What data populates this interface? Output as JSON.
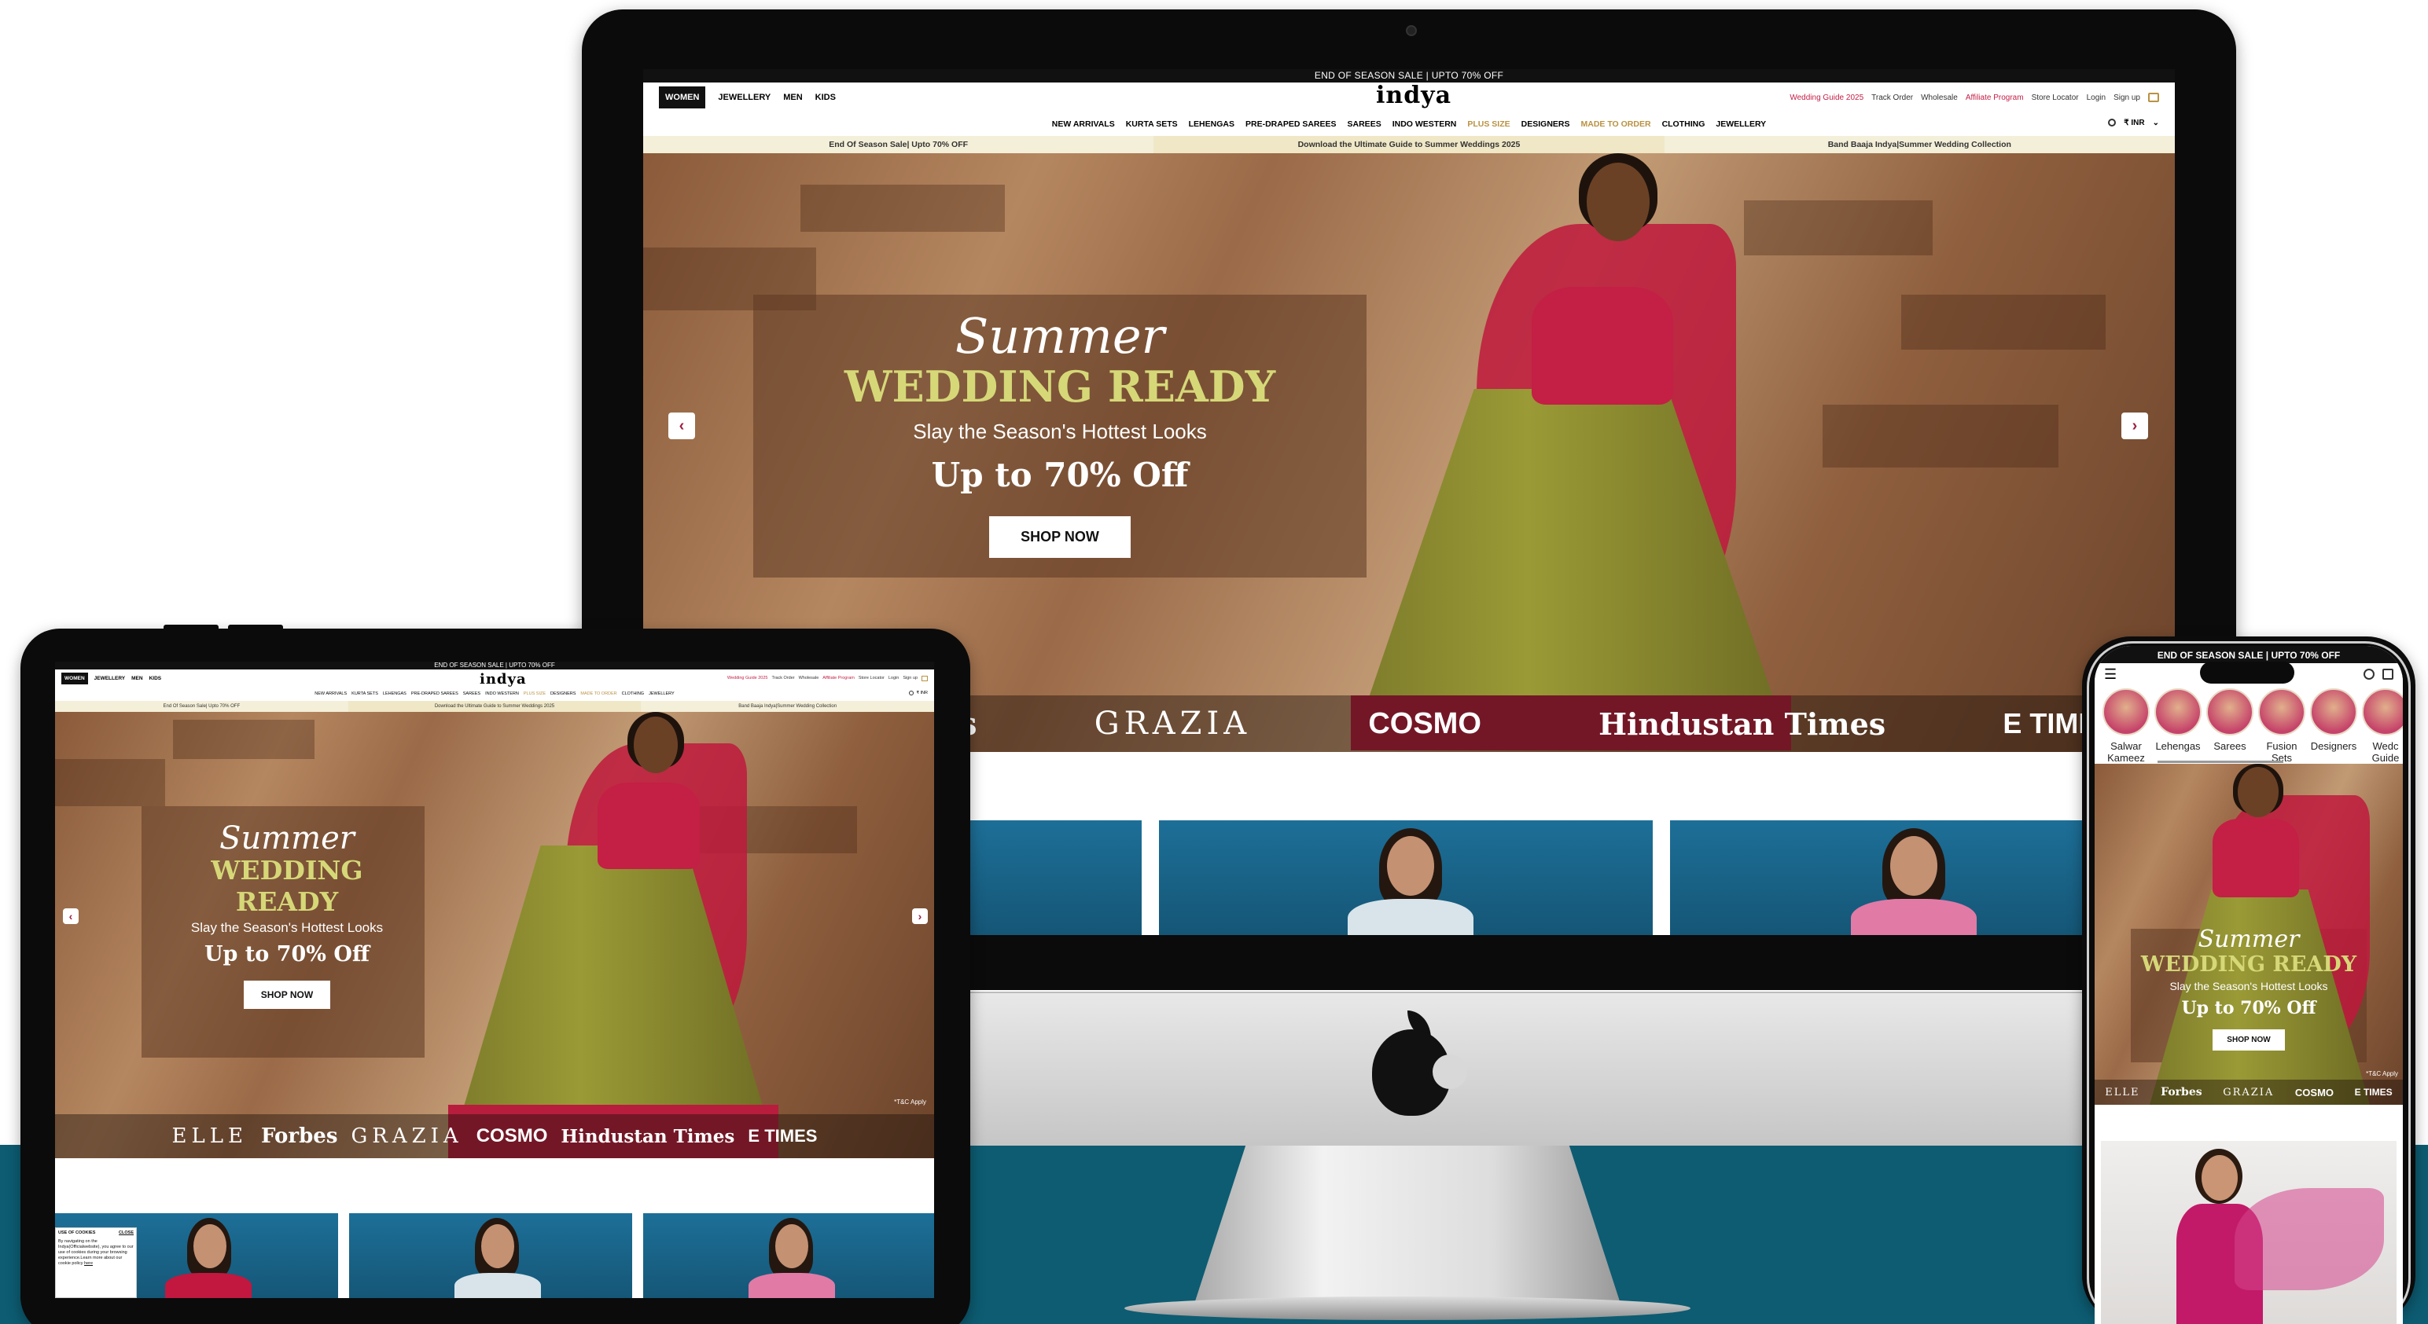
{
  "site": {
    "sale_strip": "END OF SEASON SALE | UPTO 70% OFF",
    "logo": "indya",
    "top_tabs": [
      "WOMEN",
      "JEWELLERY",
      "MEN",
      "KIDS"
    ],
    "top_links": [
      "Wedding Guide 2025",
      "Track Order",
      "Wholesale",
      "Affiliate Program",
      "Store Locator",
      "Login",
      "Sign up"
    ],
    "currency": "₹ INR",
    "nav": [
      "NEW ARRIVALS",
      "KURTA SETS",
      "LEHENGAS",
      "PRE-DRAPED SAREES",
      "SAREES",
      "INDO WESTERN",
      "PLUS SIZE",
      "DESIGNERS",
      "MADE TO ORDER",
      "CLOTHING",
      "JEWELLERY"
    ],
    "promo": [
      "End Of Season Sale| Upto 70% OFF",
      "Download the Ultimate Guide to Summer Weddings 2025",
      "Band Baaja Indya|Summer Wedding Collection"
    ],
    "hero": {
      "script": "Summer",
      "title": "WEDDING READY",
      "subtitle": "Slay the Season's Hottest Looks",
      "offer": "Up to 70% Off",
      "cta": "SHOP NOW",
      "tnc": "*T&C Apply"
    },
    "press": [
      "ELLE",
      "Forbes",
      "GRAZIA",
      "COSMO",
      "Hindustan Times",
      "E TIMES"
    ],
    "cookie": {
      "title": "USE OF COOKIES",
      "close": "CLOSE",
      "body": "By navigating on the Indya(Officialwebsite), you agree to our use of cookies during your browsing experience.Learn more about our cookie policy",
      "link": "here"
    },
    "mobile_sale_strip": "END OF SEASON SALE | UPTO 70% OFF",
    "mobile_categories": [
      "Salwar Kameez",
      "Lehengas",
      "Sarees",
      "Fusion Sets",
      "Designers",
      "Wedding Guide"
    ],
    "mobile_cat_display": [
      "Salwar\nKameez",
      "Lehengas",
      "Sarees",
      "Fusion Sets",
      "Designers",
      "Wedc\nGuide"
    ]
  },
  "colors": {
    "teal_band": "#0d5c72",
    "accent_red": "#c41f45",
    "gold": "#b99242",
    "headline": "#d6d878"
  }
}
